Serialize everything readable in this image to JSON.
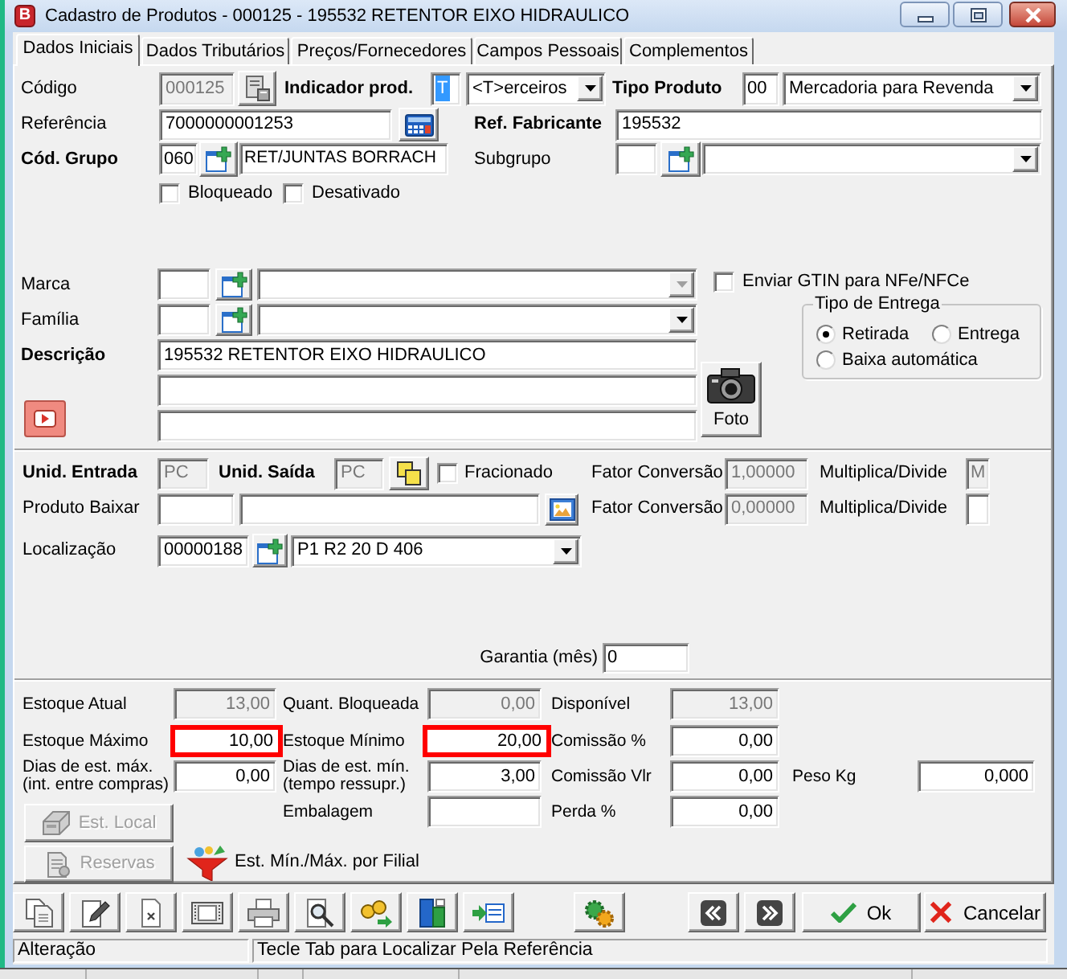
{
  "window": {
    "icon_letter": "B",
    "title": "Cadastro de Produtos - 000125 - 195532 RETENTOR EIXO HIDRAULICO"
  },
  "tabs": [
    {
      "label": "Dados Iniciais",
      "selected": true
    },
    {
      "label": "Dados Tributários",
      "selected": false
    },
    {
      "label": "Preços/Fornecedores",
      "selected": false
    },
    {
      "label": "Campos Pessoais",
      "selected": false
    },
    {
      "label": "Complementos",
      "selected": false
    }
  ],
  "general": {
    "code": {
      "label": "Código",
      "value": "000125",
      "disabled": true
    },
    "product_indicator": {
      "label": "Indicador prod.",
      "code": "T",
      "code_selected": true,
      "option": "<T>erceiros"
    },
    "product_type": {
      "label": "Tipo Produto",
      "code": "00",
      "option": "Mercadoria para Revenda"
    },
    "reference": {
      "label": "Referência",
      "value": "7000000001253"
    },
    "manufacturer_reference": {
      "label": "Ref. Fabricante",
      "value": "195532"
    },
    "group": {
      "label": "Cód. Grupo",
      "code": "060",
      "name": "RET/JUNTAS BORRACH"
    },
    "subgroup": {
      "label": "Subgrupo"
    },
    "status_flags": [
      {
        "label": "Bloqueado",
        "checked": false
      },
      {
        "label": "Desativado",
        "checked": false
      }
    ],
    "brand": {
      "label": "Marca",
      "dropdown_disabled": true
    },
    "family": {
      "label": "Família"
    },
    "send_gtin": {
      "label": "Enviar GTIN para NFe/NFCe",
      "checked": false
    },
    "delivery_type": {
      "title": "Tipo de Entrega",
      "options": [
        {
          "label": "Retirada",
          "selected": true
        },
        {
          "label": "Entrega",
          "selected": false
        },
        {
          "label": "Baixa automática",
          "selected": false
        }
      ]
    },
    "description": {
      "label": "Descrição",
      "lines": [
        "195532 RETENTOR EIXO HIDRAULICO"
      ]
    },
    "photo_button": {
      "label": "Foto"
    }
  },
  "units": {
    "entry_unit": {
      "label": "Unid. Entrada",
      "value": "PC",
      "disabled": true
    },
    "exit_unit": {
      "label": "Unid. Saída",
      "value": "PC",
      "disabled": true
    },
    "fractional": {
      "label": "Fracionado",
      "checked": false
    },
    "conversions": [
      {
        "label": "Fator Conversão",
        "value": "1,00000",
        "disabled": true,
        "operation_label": "Multiplica/Divide",
        "operation": "M",
        "operation_disabled": true
      },
      {
        "label": "Fator Conversão",
        "value": "0,00000",
        "disabled": true,
        "operation_label": "Multiplica/Divide",
        "operation_disabled": false
      }
    ],
    "product_to_deduct": {
      "label": "Produto Baixar"
    },
    "location": {
      "label": "Localização",
      "code": "00000188",
      "option": "P1 R2 20 D 406"
    },
    "warranty": {
      "label": "Garantia (mês)",
      "value": "0"
    }
  },
  "stock": {
    "current": {
      "label": "Estoque Atual",
      "value": "13,00",
      "disabled": true
    },
    "blocked": {
      "label": "Quant. Bloqueada",
      "value": "0,00",
      "disabled": true
    },
    "available": {
      "label": "Disponível",
      "value": "13,00",
      "disabled": true
    },
    "maximum": {
      "label": "Estoque Máximo",
      "value": "10,00",
      "highlighted": true
    },
    "minimum": {
      "label": "Estoque Mínimo",
      "value": "20,00",
      "highlighted": true
    },
    "commission_percent": {
      "label": "Comissão %",
      "value": "0,00"
    },
    "max_days": {
      "label": "Dias de est. máx. (int. entre compras)",
      "value": "0,00"
    },
    "min_days": {
      "label": "Dias de est. mín. (tempo ressupr.)",
      "value": "3,00"
    },
    "commission_value": {
      "label": "Comissão Vlr",
      "value": "0,00"
    },
    "weight_kg": {
      "label": "Peso Kg",
      "value": "0,000"
    },
    "packaging": {
      "label": "Embalagem"
    },
    "loss_percent": {
      "label": "Perda %",
      "value": "0,00"
    },
    "buttons": [
      {
        "label": "Est. Local",
        "disabled": true
      },
      {
        "label": "Reservas",
        "disabled": true
      }
    ],
    "branch_min_max": {
      "label": "Est. Mín./Máx. por Filial"
    }
  },
  "toolbar": {
    "actions": [
      {
        "kind": "ok",
        "label": "Ok"
      },
      {
        "kind": "cancel",
        "label": "Cancelar"
      }
    ]
  },
  "status_bar": [
    "Alteração",
    "Tecle Tab para Localizar Pela Referência"
  ]
}
